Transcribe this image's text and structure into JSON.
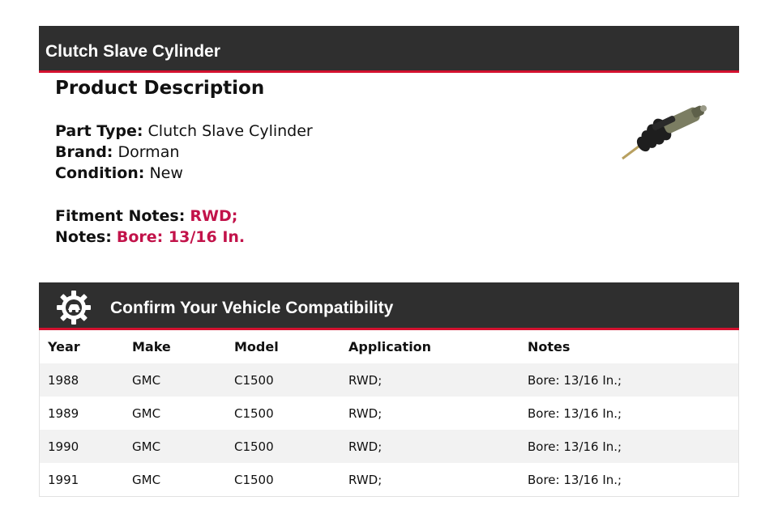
{
  "header": {
    "title": "Clutch Slave Cylinder"
  },
  "description": {
    "heading": "Product Description",
    "fields": [
      {
        "label": "Part Type:",
        "value": "Clutch Slave Cylinder"
      },
      {
        "label": "Brand:",
        "value": "Dorman"
      },
      {
        "label": "Condition:",
        "value": "New"
      }
    ],
    "fitment": {
      "label": "Fitment Notes:",
      "value": "RWD;"
    },
    "notes": {
      "label": "Notes:",
      "value": "Bore: 13/16 In."
    }
  },
  "compat": {
    "title": "Confirm Your Vehicle Compatibility",
    "icon": "gear-car-icon",
    "columns": [
      "Year",
      "Make",
      "Model",
      "Application",
      "Notes"
    ],
    "rows": [
      [
        "1988",
        "GMC",
        "C1500",
        "RWD;",
        "Bore: 13/16 In.;"
      ],
      [
        "1989",
        "GMC",
        "C1500",
        "RWD;",
        "Bore: 13/16 In.;"
      ],
      [
        "1990",
        "GMC",
        "C1500",
        "RWD;",
        "Bore: 13/16 In.;"
      ],
      [
        "1991",
        "GMC",
        "C1500",
        "RWD;",
        "Bore: 13/16 In.;"
      ]
    ]
  },
  "colors": {
    "header_bg": "#2f2f2f",
    "accent": "#d3112f",
    "highlight_text": "#c2134a"
  }
}
